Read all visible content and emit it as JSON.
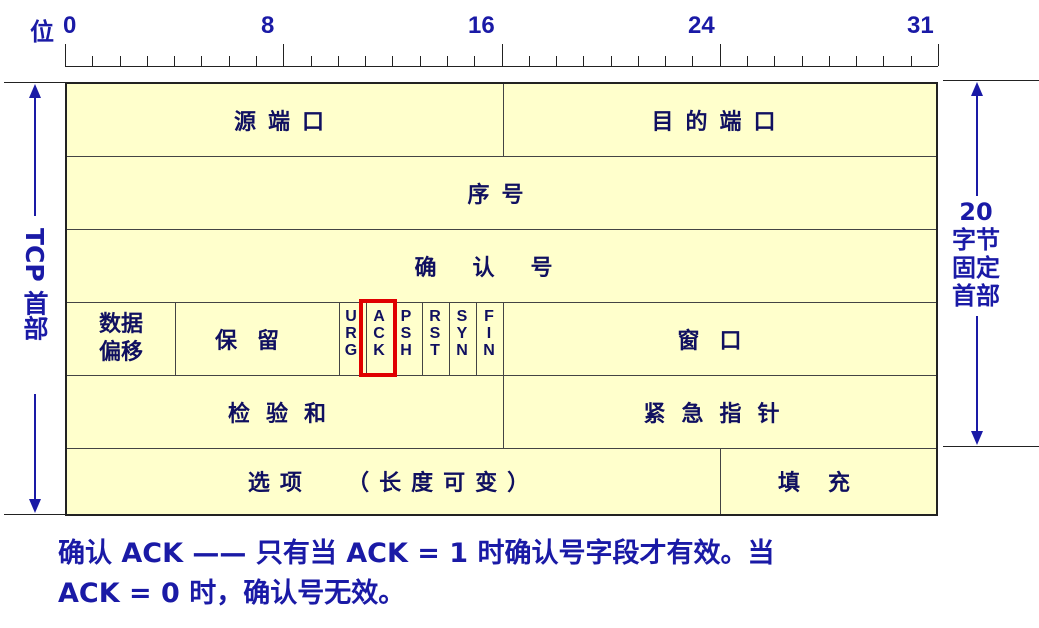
{
  "ruler": {
    "unit_label": "位",
    "ticks": [
      "0",
      "8",
      "16",
      "24",
      "31"
    ]
  },
  "side": {
    "left_label": "TCP 首部",
    "right_number": "20",
    "right_lines": [
      "字节",
      "固定",
      "首部"
    ]
  },
  "fields": {
    "src_port": "源端口",
    "dst_port": "目的端口",
    "seq": "序号",
    "ack_num": "确认号",
    "data_offset": [
      "数据",
      "偏移"
    ],
    "reserved": "保留",
    "flags": [
      [
        "U",
        "R",
        "G"
      ],
      [
        "A",
        "C",
        "K"
      ],
      [
        "P",
        "S",
        "H"
      ],
      [
        "R",
        "S",
        "T"
      ],
      [
        "S",
        "Y",
        "N"
      ],
      [
        "F",
        "I",
        "N"
      ]
    ],
    "window": "窗口",
    "checksum": "检验和",
    "urgent_ptr": "紧急指针",
    "options": "选项  （长度可变）",
    "padding": "填充"
  },
  "highlight_color": "#e00000",
  "note": {
    "line1": "确认 ACK —— 只有当 ACK = 1 时确认号字段才有效。当",
    "line2": "ACK = 0 时，确认号无效。"
  }
}
